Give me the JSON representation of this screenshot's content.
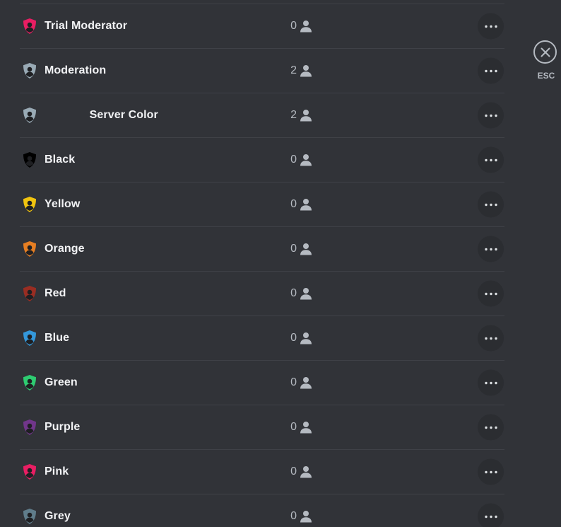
{
  "roles": [
    {
      "name": "Trial Moderator",
      "count": "0",
      "color": "#e91e63"
    },
    {
      "name": "Moderation",
      "count": "2",
      "color": "#99aab5"
    },
    {
      "name": "              Server Color",
      "count": "2",
      "color": "#99aab5"
    },
    {
      "name": "Black",
      "count": "0",
      "color": "#000000"
    },
    {
      "name": "Yellow",
      "count": "0",
      "color": "#f1c40f"
    },
    {
      "name": "Orange",
      "count": "0",
      "color": "#e67e22"
    },
    {
      "name": "Red",
      "count": "0",
      "color": "#992d22"
    },
    {
      "name": "Blue",
      "count": "0",
      "color": "#3498db"
    },
    {
      "name": "Green",
      "count": "0",
      "color": "#2ecc71"
    },
    {
      "name": "Purple",
      "count": "0",
      "color": "#71368a"
    },
    {
      "name": "Pink",
      "count": "0",
      "color": "#e91e63"
    },
    {
      "name": "Grey",
      "count": "0",
      "color": "#607d8b"
    }
  ],
  "icons": {
    "role": "shield-icon",
    "members": "person-icon",
    "more": "more-options-icon",
    "close": "close-icon"
  },
  "close": {
    "label": "ESC"
  },
  "theme": {
    "background": "#313338",
    "divider": "#3f4147",
    "text": "#f2f3f5",
    "muted": "#b5bac1",
    "button": "#2b2d31"
  }
}
